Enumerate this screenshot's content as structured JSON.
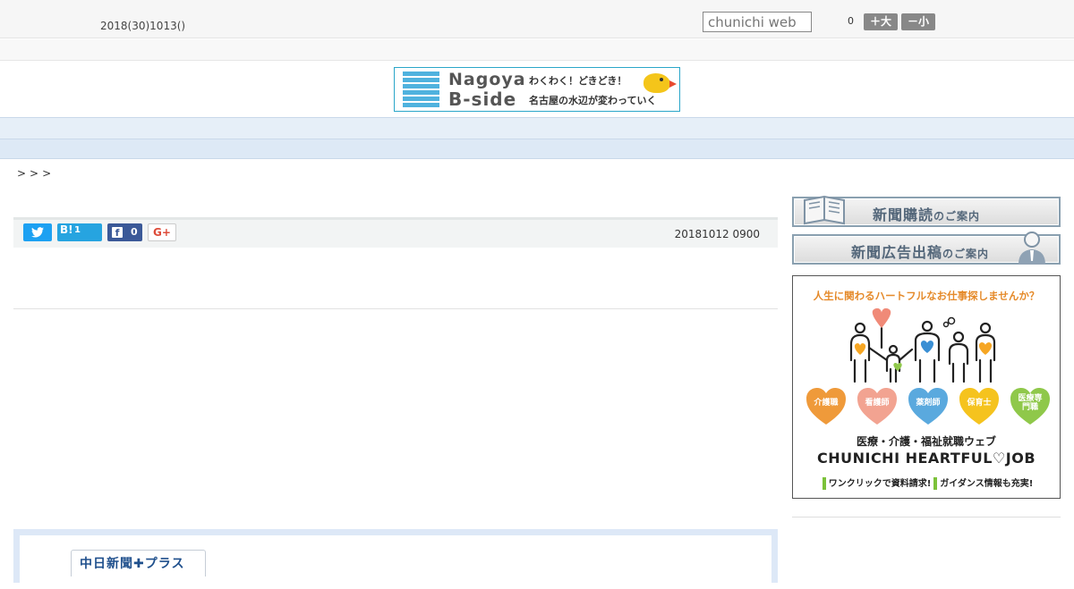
{
  "header": {
    "date": "2018(30)1013()",
    "search_placeholder": "chunichi web",
    "font_size_count": "0",
    "font_larger_label": "＋大",
    "font_smaller_label": "－小"
  },
  "banner": {
    "title_line1": "Nagoya",
    "title_line2": "B-side",
    "subtitle_line1": "わくわく！どきどき！",
    "subtitle_line2": "名古屋の水辺が変わっていく"
  },
  "nav": {
    "items": [
      "　　",
      "　　",
      "　　",
      "　　",
      "　　",
      "　　",
      "　　",
      "　　",
      "　　"
    ]
  },
  "breadcrumb": ">>>",
  "share": {
    "hatena_label": "B!",
    "hatena_count": "1",
    "facebook_count": "0",
    "googleplus_label": "G+",
    "timestamp": "20181012 0900"
  },
  "plus_box": {
    "logo_text": "中日新聞✚プラス"
  },
  "sidebar": {
    "subscribe_main": "新聞購読",
    "subscribe_sub": "のご案内",
    "advertise_main": "新聞広告出稿",
    "advertise_sub": "のご案内",
    "ad": {
      "headline": "人生に関わるハートフルなお仕事探しませんか？",
      "jobs": [
        {
          "label": "介護職",
          "color": "#ef9a3a"
        },
        {
          "label": "看護師",
          "color": "#f2a391"
        },
        {
          "label": "薬剤師",
          "color": "#5aa9de"
        },
        {
          "label": "保育士",
          "color": "#f5c31e"
        },
        {
          "label": "医療専門職",
          "color": "#8fc84a"
        }
      ],
      "line1": "医療・介護・福祉就職ウェブ",
      "line2": "CHUNICHI HEARTFUL♡JOB",
      "line3a": "ワンクリックで資料請求!",
      "line3b": "ガイダンス情報も充実!"
    }
  },
  "colors": {
    "nav_bg": "#e6eff8",
    "twitter": "#1da1f2",
    "hatena": "#26a4e0",
    "facebook": "#3b5998",
    "googleplus": "#dd4b39"
  }
}
